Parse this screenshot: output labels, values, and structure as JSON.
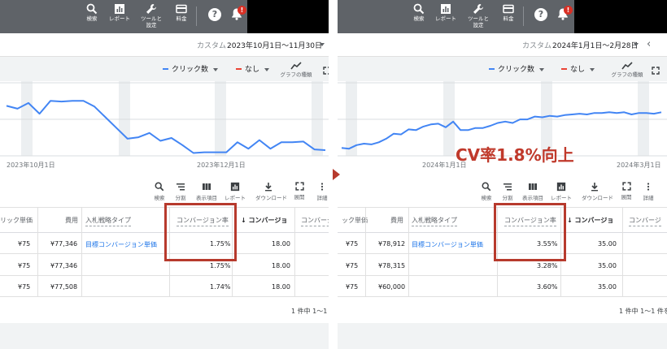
{
  "topbar": {
    "search": "検索",
    "reports": "レポート",
    "tools_l1": "ツールと",
    "tools_l2": "設定",
    "billing": "料金",
    "help": "?",
    "alert": "!"
  },
  "before": {
    "date_prefix": "カスタム",
    "date_range": "2023年10月1日〜11月30日",
    "metric1": "クリック数",
    "metric2": "なし",
    "graph_type": "グラフの種類",
    "expand_cut": "展開",
    "x_ticks": [
      "2023年10月1日",
      "2023年12月1日"
    ],
    "series_y": [
      0.7,
      0.66,
      0.74,
      0.59,
      0.77,
      0.76,
      0.77,
      0.77,
      0.69,
      0.54,
      0.39,
      0.24,
      0.26,
      0.32,
      0.21,
      0.25,
      0.15,
      0.04,
      0.05,
      0.05,
      0.05,
      0.19,
      0.1,
      0.22,
      0.1,
      0.19,
      0.19,
      0.2,
      0.09,
      0.08
    ],
    "headers": {
      "cpc": "リック単価",
      "cost": "費用",
      "strategy": "入札戦略タイプ",
      "conv_rate": "コンバージョン率",
      "conv": "コンバージョ",
      "conv_value": "コンバージ"
    },
    "rows": [
      {
        "cpc": "¥75",
        "cost": "¥77,346",
        "strategy": "目標コンバージョン単価",
        "conv_rate": "1.75%",
        "conv": "18.00"
      },
      {
        "cpc": "¥75",
        "cost": "¥77,346",
        "strategy": "",
        "conv_rate": "1.75%",
        "conv": "18.00"
      },
      {
        "cpc": "¥75",
        "cost": "¥77,508",
        "strategy": "",
        "conv_rate": "1.74%",
        "conv": "18.00"
      }
    ],
    "footer": "1 件中 1〜1"
  },
  "after": {
    "date_prefix": "カスタム",
    "date_range": "2024年1月1日〜2月28日",
    "metric1": "クリック数",
    "metric2": "なし",
    "graph_type": "グラフの種類",
    "expand_cut": "展開",
    "x_ticks": [
      "2024年1月1日",
      "2024年3月1日"
    ],
    "series_y": [
      0.11,
      0.1,
      0.15,
      0.17,
      0.16,
      0.19,
      0.24,
      0.31,
      0.3,
      0.37,
      0.36,
      0.41,
      0.44,
      0.45,
      0.4,
      0.48,
      0.36,
      0.36,
      0.39,
      0.39,
      0.42,
      0.46,
      0.48,
      0.46,
      0.51,
      0.51,
      0.55,
      0.54,
      0.56,
      0.55,
      0.57,
      0.58,
      0.59,
      0.58,
      0.6,
      0.6,
      0.61,
      0.6,
      0.61,
      0.58,
      0.6,
      0.6,
      0.59,
      0.61
    ],
    "headers": {
      "cpc": "ック単価",
      "cost": "費用",
      "strategy": "入札戦略タイプ",
      "conv_rate": "コンバージョン率",
      "conv": "コンバージョ",
      "conv_value": "コンバージ"
    },
    "rows": [
      {
        "cpc": "¥75",
        "cost": "¥78,912",
        "strategy": "目標コンバージョン単価",
        "conv_rate": "3.55%",
        "conv": "35.00"
      },
      {
        "cpc": "¥75",
        "cost": "¥78,315",
        "strategy": "",
        "conv_rate": "3.28%",
        "conv": "35.00"
      },
      {
        "cpc": "¥75",
        "cost": "¥60,000",
        "strategy": "",
        "conv_rate": "3.60%",
        "conv": "35.00"
      }
    ],
    "footer": "1 件中 1〜1 件を"
  },
  "toolbar": {
    "search": "検索",
    "segment": "分割",
    "columns": "表示項目",
    "reports": "レポート",
    "download": "ダウンロード",
    "expand": "展開",
    "details": "詳細"
  },
  "callout": "CV率1.8%向上",
  "colors": {
    "topbar": "#5f6368",
    "line": "#4285f4",
    "metric1": "#4285f4",
    "metric2": "#ea4335",
    "highlight": "#b73a2d",
    "callout": "#c0392b",
    "link": "#1a73e8"
  },
  "icons": [
    "search-icon",
    "reports-icon",
    "wrench-icon",
    "billing-icon",
    "help-icon",
    "bell-icon",
    "graph-type-icon",
    "expand-icon",
    "filter-icon",
    "columns-icon",
    "download-icon",
    "sort-arrow-icon",
    "chevron-left-icon"
  ]
}
